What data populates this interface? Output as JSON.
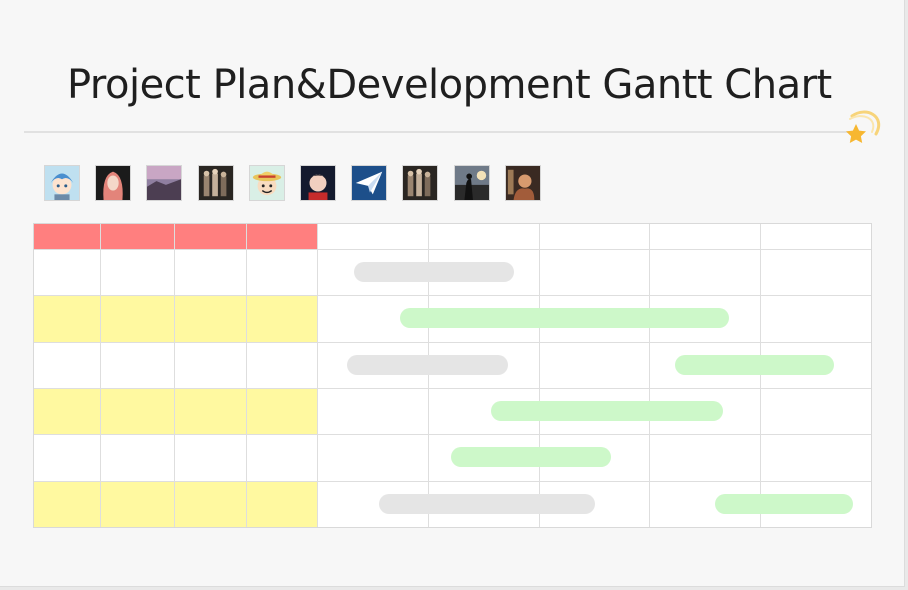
{
  "page": {
    "title": "Project Plan&Development Gantt Chart"
  },
  "colors": {
    "header": "#ff7f7f",
    "stripe": "#fff9a0",
    "bar_gray": "#e5e5e5",
    "bar_green": "#cdf8c9",
    "star": "#f7b731"
  },
  "decor": {
    "icon": "star-icon"
  },
  "collaborators": [
    {
      "icon": "avatar-anime-blue-hair"
    },
    {
      "icon": "avatar-red-hair-girl"
    },
    {
      "icon": "avatar-pink-sky"
    },
    {
      "icon": "avatar-group-photo"
    },
    {
      "icon": "avatar-straw-hat-cartoon"
    },
    {
      "icon": "avatar-dark-anime"
    },
    {
      "icon": "avatar-paper-plane"
    },
    {
      "icon": "avatar-group-photo"
    },
    {
      "icon": "avatar-silhouette-sunset"
    },
    {
      "icon": "avatar-warm-portrait"
    }
  ],
  "gantt": {
    "info_columns": 4,
    "timeline_columns": 5,
    "rows": [
      {
        "stripe": false,
        "bars": [
          {
            "style": "gray",
            "start": 0.33,
            "end": 1.78
          }
        ]
      },
      {
        "stripe": true,
        "bars": [
          {
            "style": "green",
            "start": 0.75,
            "end": 3.72
          }
        ]
      },
      {
        "stripe": false,
        "bars": [
          {
            "style": "gray",
            "start": 0.27,
            "end": 1.72
          },
          {
            "style": "green",
            "start": 3.23,
            "end": 4.67
          }
        ]
      },
      {
        "stripe": true,
        "bars": [
          {
            "style": "green",
            "start": 1.57,
            "end": 3.66
          }
        ]
      },
      {
        "stripe": false,
        "bars": [
          {
            "style": "green",
            "start": 1.21,
            "end": 2.65
          }
        ]
      },
      {
        "stripe": true,
        "bars": [
          {
            "style": "gray",
            "start": 0.56,
            "end": 2.51
          },
          {
            "style": "green",
            "start": 3.59,
            "end": 4.84
          }
        ]
      }
    ]
  }
}
